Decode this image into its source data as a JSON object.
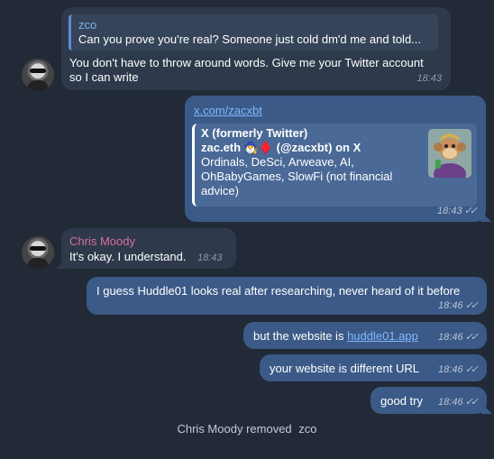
{
  "messages": {
    "m1": {
      "reply_name": "zco",
      "reply_text": "Can you prove you're real? Someone just cold dm'd me and told...",
      "line1": "You don't have to throw around words. Give me your Twitter account",
      "line2": "so I can write",
      "time": "18:43"
    },
    "m2": {
      "link": "x.com/zacxbt",
      "preview_title": "X (formerly Twitter)",
      "preview_line1": "zac.eth 🧙‍♂️♦️ (@zacxbt) on X",
      "preview_line2": "Ordinals, DeSci, Arweave, AI,",
      "preview_line3": "OhBabyGames, SlowFi (not financial",
      "preview_line4": "advice)",
      "time": "18:43",
      "status": "✓✓"
    },
    "m3": {
      "sender": "Chris Moody",
      "text": "It's okay. I understand.",
      "time": "18:43"
    },
    "m4": {
      "text": "I guess Huddle01 looks real after researching, never heard of it before",
      "time": "18:46",
      "status": "✓✓"
    },
    "m5": {
      "text_before": "but the website is",
      "link": "huddle01.app",
      "time": "18:46",
      "status": "✓✓"
    },
    "m6": {
      "text": "your website is different URL",
      "time": "18:46",
      "status": "✓✓"
    },
    "m7": {
      "text": "good try",
      "time": "18:46",
      "status": "✓✓"
    }
  },
  "service": {
    "actor": "Chris Moody",
    "action": "removed",
    "target": "zco"
  },
  "colors": {
    "background": "#212a36",
    "incoming_bubble": "#2e3a4b",
    "outgoing_bubble": "#3c5a87",
    "sender_name": "#d66f9c",
    "link": "#7fb8ff"
  }
}
